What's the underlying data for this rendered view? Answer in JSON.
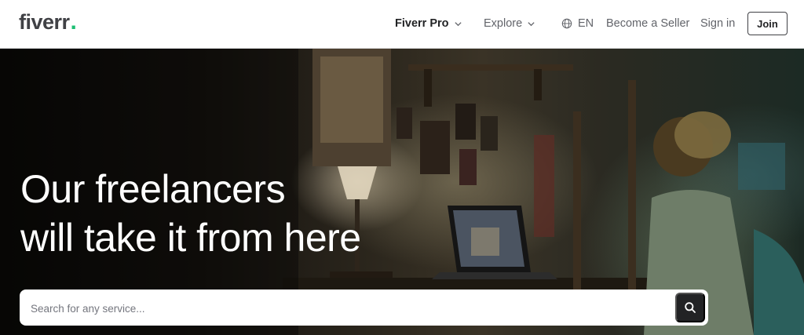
{
  "header": {
    "logo_text": "fiverr",
    "logo_dot": ".",
    "nav": {
      "pro_label": "Fiverr Pro",
      "explore_label": "Explore",
      "language_label": "EN",
      "seller_label": "Become a Seller",
      "signin_label": "Sign in",
      "join_label": "Join"
    },
    "icons": {
      "pro_chevron": "chevron-down-icon",
      "explore_chevron": "chevron-down-icon",
      "language": "globe-icon"
    }
  },
  "hero": {
    "title_line1": "Our freelancers",
    "title_line2": "will take it from here",
    "search": {
      "placeholder": "Search for any service...",
      "value": "",
      "button_icon": "search-icon"
    }
  },
  "colors": {
    "brand_green": "#1dbf73",
    "logo_text": "#404145",
    "nav_text": "#62646a",
    "search_button": "#222325"
  }
}
